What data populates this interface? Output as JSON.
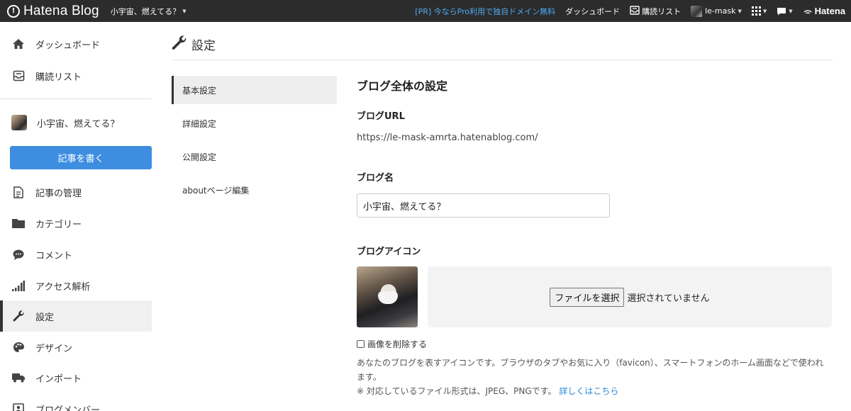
{
  "topbar": {
    "brand": "Hatena Blog",
    "blog_switch": "小宇宙、燃えてる？",
    "pr_text": "[PR] 今ならPro利用で独自ドメイン無料",
    "dashboard": "ダッシュボード",
    "reading_list": "購読リスト",
    "user": "le-mask",
    "hatena": "Hatena"
  },
  "sidebar": {
    "dashboard": "ダッシュボード",
    "reading_list": "購読リスト",
    "blog_name": "小宇宙、燃えてる？",
    "write_button": "記事を書く",
    "manage_posts": "記事の管理",
    "categories": "カテゴリー",
    "comments": "コメント",
    "analytics": "アクセス解析",
    "settings": "設定",
    "design": "デザイン",
    "import": "インポート",
    "members": "ブログメンバー"
  },
  "page": {
    "title": "設定"
  },
  "subnav": [
    "基本設定",
    "詳細設定",
    "公開設定",
    "aboutページ編集"
  ],
  "form": {
    "section_title": "ブログ全体の設定",
    "url_label": "ブログURL",
    "url_value": "https://le-mask-amrta.hatenablog.com/",
    "name_label": "ブログ名",
    "name_value": "小宇宙、燃えてる？",
    "icon_label": "ブログアイコン",
    "file_button": "ファイルを選択",
    "file_status": "選択されていません",
    "delete_label": "画像を削除する",
    "help_text": "あなたのブログを表すアイコンです。ブラウザのタブやお気に入り（favicon）、スマートフォンのホーム画面などで使われます。",
    "formats_text": "※ 対応しているファイル形式は、JPEG、PNGです。",
    "details_link": "詳しくはこちら"
  },
  "colors": {
    "topbar": "#2c2c2c",
    "accent": "#3d8ee0",
    "link": "#2b88d8",
    "pr": "#4fa8ee"
  }
}
